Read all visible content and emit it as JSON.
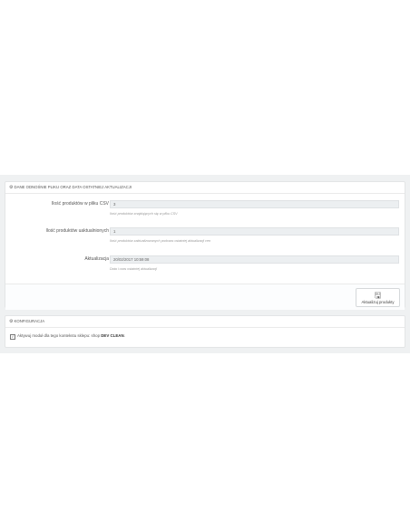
{
  "panel_import": {
    "title": "DANE ODNOŚNIE PLIKU ORAZ DATA OSTATNIEJ AKTUALIZACJI",
    "fields": [
      {
        "label": "Ilość produktów w pliku CSV",
        "value": "3",
        "help": "Ilość produktów znajdujących się w pliku CSV"
      },
      {
        "label": "Ilość produktów uaktualnionych",
        "value": "1",
        "help": "Ilość produktów zaktualizowanych podczas ostatniej aktualizacji cen"
      },
      {
        "label": "Aktualizacja",
        "value": "20/02/2017 10:59:08",
        "help": "Data i czas ostatniej aktualizacji"
      }
    ],
    "save_button_label": "Aktualizuj produkty"
  },
  "panel_config": {
    "title": "KONFIGURACJA",
    "text_before": "Aktywuj moduł dla tego kontekstu sklepu: shop ",
    "shop_name": "DEV CLEAN",
    "text_after": "."
  },
  "icons": {
    "heading": "cogs-icon",
    "save": "save-icon",
    "checkbox": "checkbox-icon"
  }
}
